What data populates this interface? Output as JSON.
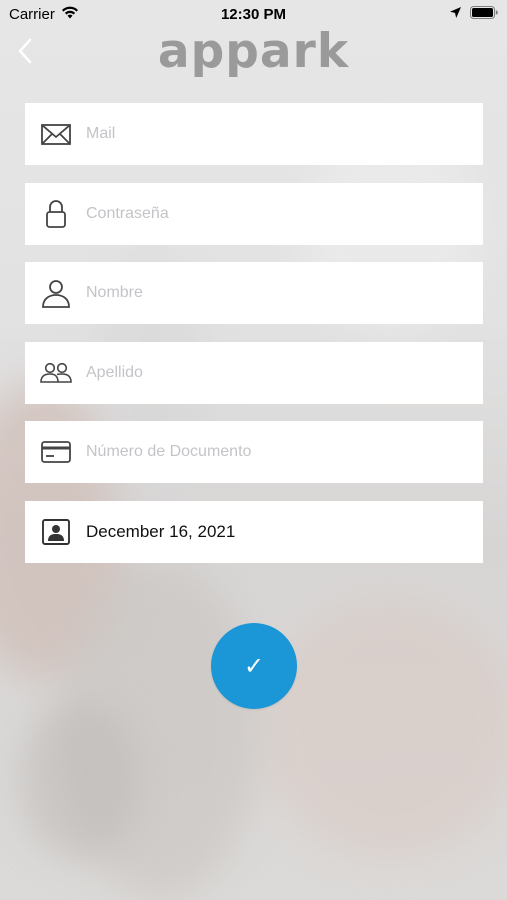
{
  "status_bar": {
    "carrier": "Carrier",
    "time": "12:30 PM"
  },
  "header": {
    "logo_text": "appark",
    "back_icon": "chevron-left-icon"
  },
  "form": {
    "fields": [
      {
        "icon": "mail-icon",
        "placeholder": "Mail",
        "value": ""
      },
      {
        "icon": "lock-icon",
        "placeholder": "Contraseña",
        "value": ""
      },
      {
        "icon": "user-icon",
        "placeholder": "Nombre",
        "value": ""
      },
      {
        "icon": "users-icon",
        "placeholder": "Apellido",
        "value": ""
      },
      {
        "icon": "id-card-icon",
        "placeholder": "Número de Documento",
        "value": ""
      }
    ],
    "birthdate": {
      "icon": "contact-card-icon",
      "value": "December 16, 2021"
    }
  },
  "submit": {
    "icon": "checkmark-icon",
    "glyph": "✓"
  },
  "colors": {
    "accent": "#1b96d6",
    "logo": "#9a9a9a",
    "placeholder": "#c4c4c8",
    "field_bg": "#ffffff"
  }
}
